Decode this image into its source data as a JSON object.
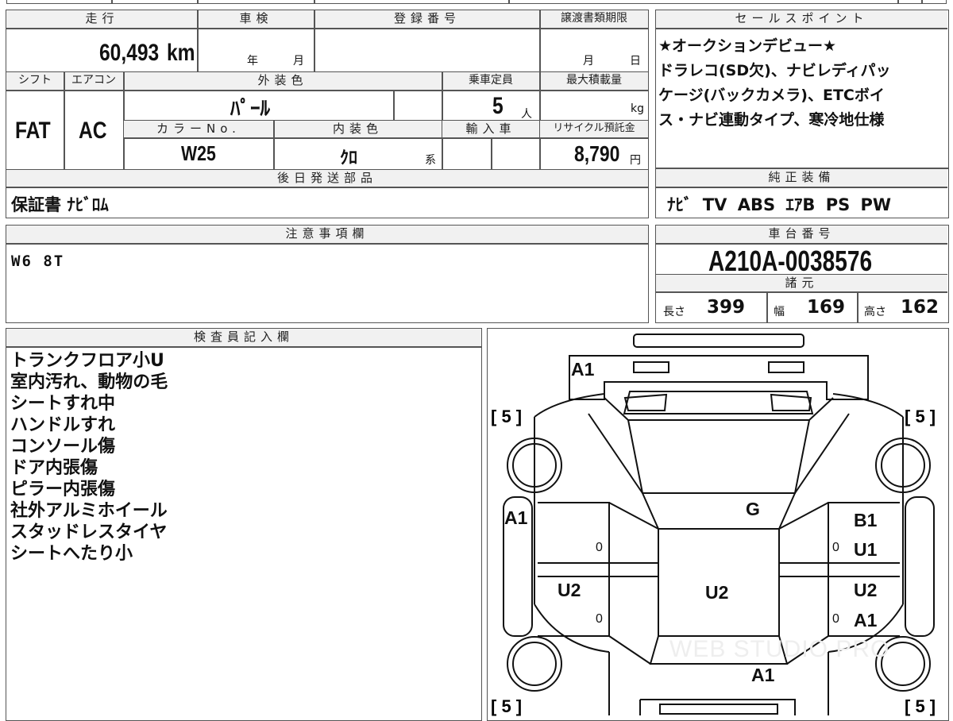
{
  "mileage": {
    "header": "走行",
    "value": "60,493",
    "unit": "km"
  },
  "inspection": {
    "header": "車検",
    "year_unit": "年",
    "month_unit": "月"
  },
  "registration": {
    "header": "登録番号"
  },
  "transfer_deadline": {
    "header": "譲渡書類期限",
    "month_unit": "月",
    "day_unit": "日"
  },
  "shift": {
    "header": "シフト",
    "value": "FAT"
  },
  "aircon": {
    "header": "エアコン",
    "value": "AC"
  },
  "exterior_color": {
    "header": "外装色",
    "value": "ﾊﾟｰﾙ"
  },
  "capacity": {
    "header": "乗車定員",
    "value": "5",
    "unit": "人"
  },
  "max_load": {
    "header": "最大積載量",
    "unit": "kg"
  },
  "color_no": {
    "header": "カラーNo.",
    "value": "W25"
  },
  "interior_color": {
    "header": "内装色",
    "value": "ｸﾛ",
    "suffix": "系"
  },
  "import": {
    "header": "輸入車"
  },
  "recycle_fee": {
    "header": "リサイクル預託金",
    "value": "8,790",
    "unit": "円"
  },
  "sales_point": {
    "header": "セールスポイント",
    "text": "★オークションデビュー★\nドラレコ(SD欠)、ナビレディパッ\nケージ(バックカメラ)、ETCボイ\nス・ナビ連動タイプ、寒冷地仕様"
  },
  "later_parts": {
    "header": "後日発送部品",
    "value": "保証書 ﾅﾋﾞﾛﾑ"
  },
  "equipment": {
    "header": "純正装備",
    "value": "ﾅﾋﾞ TV ABS ｴｱB PS PW"
  },
  "notes": {
    "header": "注意事項欄",
    "value": "W6 8T"
  },
  "chassis": {
    "header": "車台番号",
    "value": "A210A-0038576"
  },
  "specs": {
    "header": "諸元",
    "length_label": "長さ",
    "length": "399",
    "width_label": "幅",
    "width": "169",
    "height_label": "高さ",
    "height": "162"
  },
  "inspector": {
    "header": "検査員記入欄",
    "items": [
      "トランクフロア小U",
      "室内汚れ、動物の毛",
      "シートすれ中",
      "ハンドルすれ",
      "コンソール傷",
      "ドア内張傷",
      "ピラー内張傷",
      "社外アルミホイール",
      "スタッドレスタイヤ",
      "シートへたり小"
    ]
  },
  "diagram": {
    "tread_fl": "[ 5 ]",
    "tread_fr": "[ 5 ]",
    "tread_rl": "[ 5 ]",
    "tread_rr": "[ 5 ]",
    "mark_rear": "A1",
    "mark_left_front": "A1",
    "mark_roof": "G",
    "mark_right_front_1": "B1",
    "mark_right_front_2": "U1",
    "mark_left_rear": "U2",
    "mark_center": "U2",
    "mark_right_rear_1": "U2",
    "mark_right_rear_2": "A1",
    "mark_bottom": "A1",
    "zero_1": "0",
    "zero_2": "0",
    "zero_3": "0",
    "zero_4": "0",
    "watermark": "WEB STUDIO PRO"
  }
}
